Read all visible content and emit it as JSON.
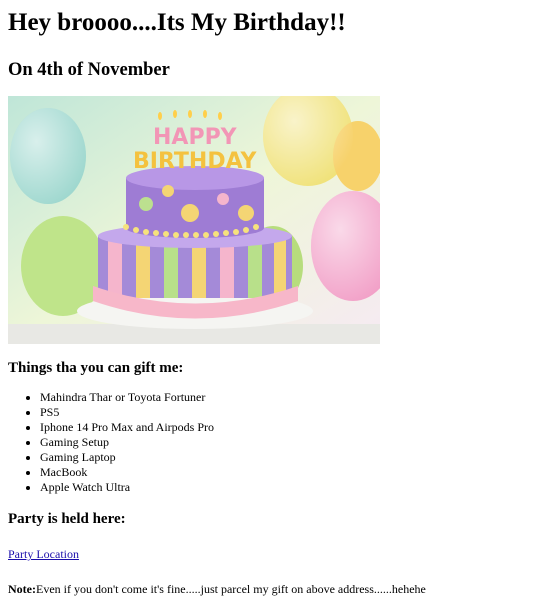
{
  "heading": "Hey broooo....Its My Birthday!!",
  "date": "On 4th of November",
  "image": {
    "alt": "Birthday cake",
    "lettering": "HAPPY BIRTHDAY"
  },
  "gifts": {
    "title": "Things tha you can gift me:",
    "items": [
      "Mahindra Thar or Toyota Fortuner",
      "PS5",
      "Iphone 14 Pro Max and Airpods Pro",
      "Gaming Setup",
      "Gaming Laptop",
      "MacBook",
      "Apple Watch Ultra"
    ]
  },
  "party": {
    "title": "Party is held here:",
    "link_text": "Party Location"
  },
  "note": {
    "label": "Note:",
    "text": "Even if you don't come it's fine.....just parcel my gift on above address......hehehe"
  },
  "colors": {
    "link": "#1a0dab",
    "cake_top": "#a77ad3",
    "cake_bottom": "#9c7bd6",
    "plate_ribbon": "#f7b7c9"
  }
}
